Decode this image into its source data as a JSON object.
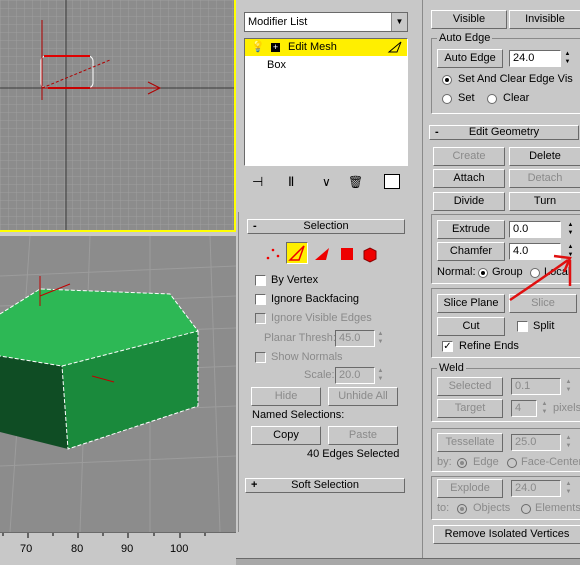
{
  "colors": {
    "accent": "#ffef00",
    "viewport_border": "#ffff00",
    "mesh_green": "#1e9a44",
    "arrow": "#e01010"
  },
  "ruler": {
    "ticks": [
      "70",
      "80",
      "90",
      "100"
    ]
  },
  "modifier_stack": {
    "dropdown_label": "Modifier List",
    "items": [
      {
        "label": "Edit Mesh",
        "selected": true
      },
      {
        "label": "Box",
        "selected": false
      }
    ]
  },
  "top_buttons": {
    "visible": "Visible",
    "invisible": "Invisible"
  },
  "auto_edge": {
    "title": "Auto Edge",
    "button": "Auto Edge",
    "threshold": "24.0",
    "options": [
      "Set And Clear Edge Vis",
      "Set",
      "Clear"
    ]
  },
  "selection": {
    "title": "Selection",
    "by_vertex": "By Vertex",
    "ignore_backfacing": "Ignore Backfacing",
    "ignore_visible_edges": "Ignore Visible Edges",
    "planar_thresh_label": "Planar Thresh:",
    "planar_thresh_value": "45.0",
    "show_normals": "Show Normals",
    "scale_label": "Scale:",
    "scale_value": "20.0",
    "hide": "Hide",
    "unhide_all": "Unhide All",
    "named_selections": "Named Selections:",
    "copy": "Copy",
    "paste": "Paste",
    "status": "40 Edges Selected"
  },
  "soft_selection": {
    "title": "Soft Selection"
  },
  "edit_geometry": {
    "title": "Edit Geometry",
    "create": "Create",
    "delete": "Delete",
    "attach": "Attach",
    "detach": "Detach",
    "divide": "Divide",
    "turn": "Turn",
    "extrude": "Extrude",
    "extrude_value": "0.0",
    "chamfer": "Chamfer",
    "chamfer_value": "4.0",
    "normal_label": "Normal:",
    "group": "Group",
    "local": "Local",
    "slice_plane": "Slice Plane",
    "slice": "Slice",
    "cut": "Cut",
    "split": "Split",
    "refine_ends": "Refine Ends"
  },
  "weld": {
    "title": "Weld",
    "selected": "Selected",
    "selected_value": "0.1",
    "target": "Target",
    "target_value": "4",
    "pixels": "pixels"
  },
  "tessellate": {
    "button": "Tessellate",
    "value": "25.0",
    "by_label": "by:",
    "edge": "Edge",
    "face_center": "Face-Center"
  },
  "explode": {
    "button": "Explode",
    "value": "24.0",
    "to_label": "to:",
    "objects": "Objects",
    "elements": "Elements"
  },
  "remove_isolated": "Remove Isolated Vertices"
}
